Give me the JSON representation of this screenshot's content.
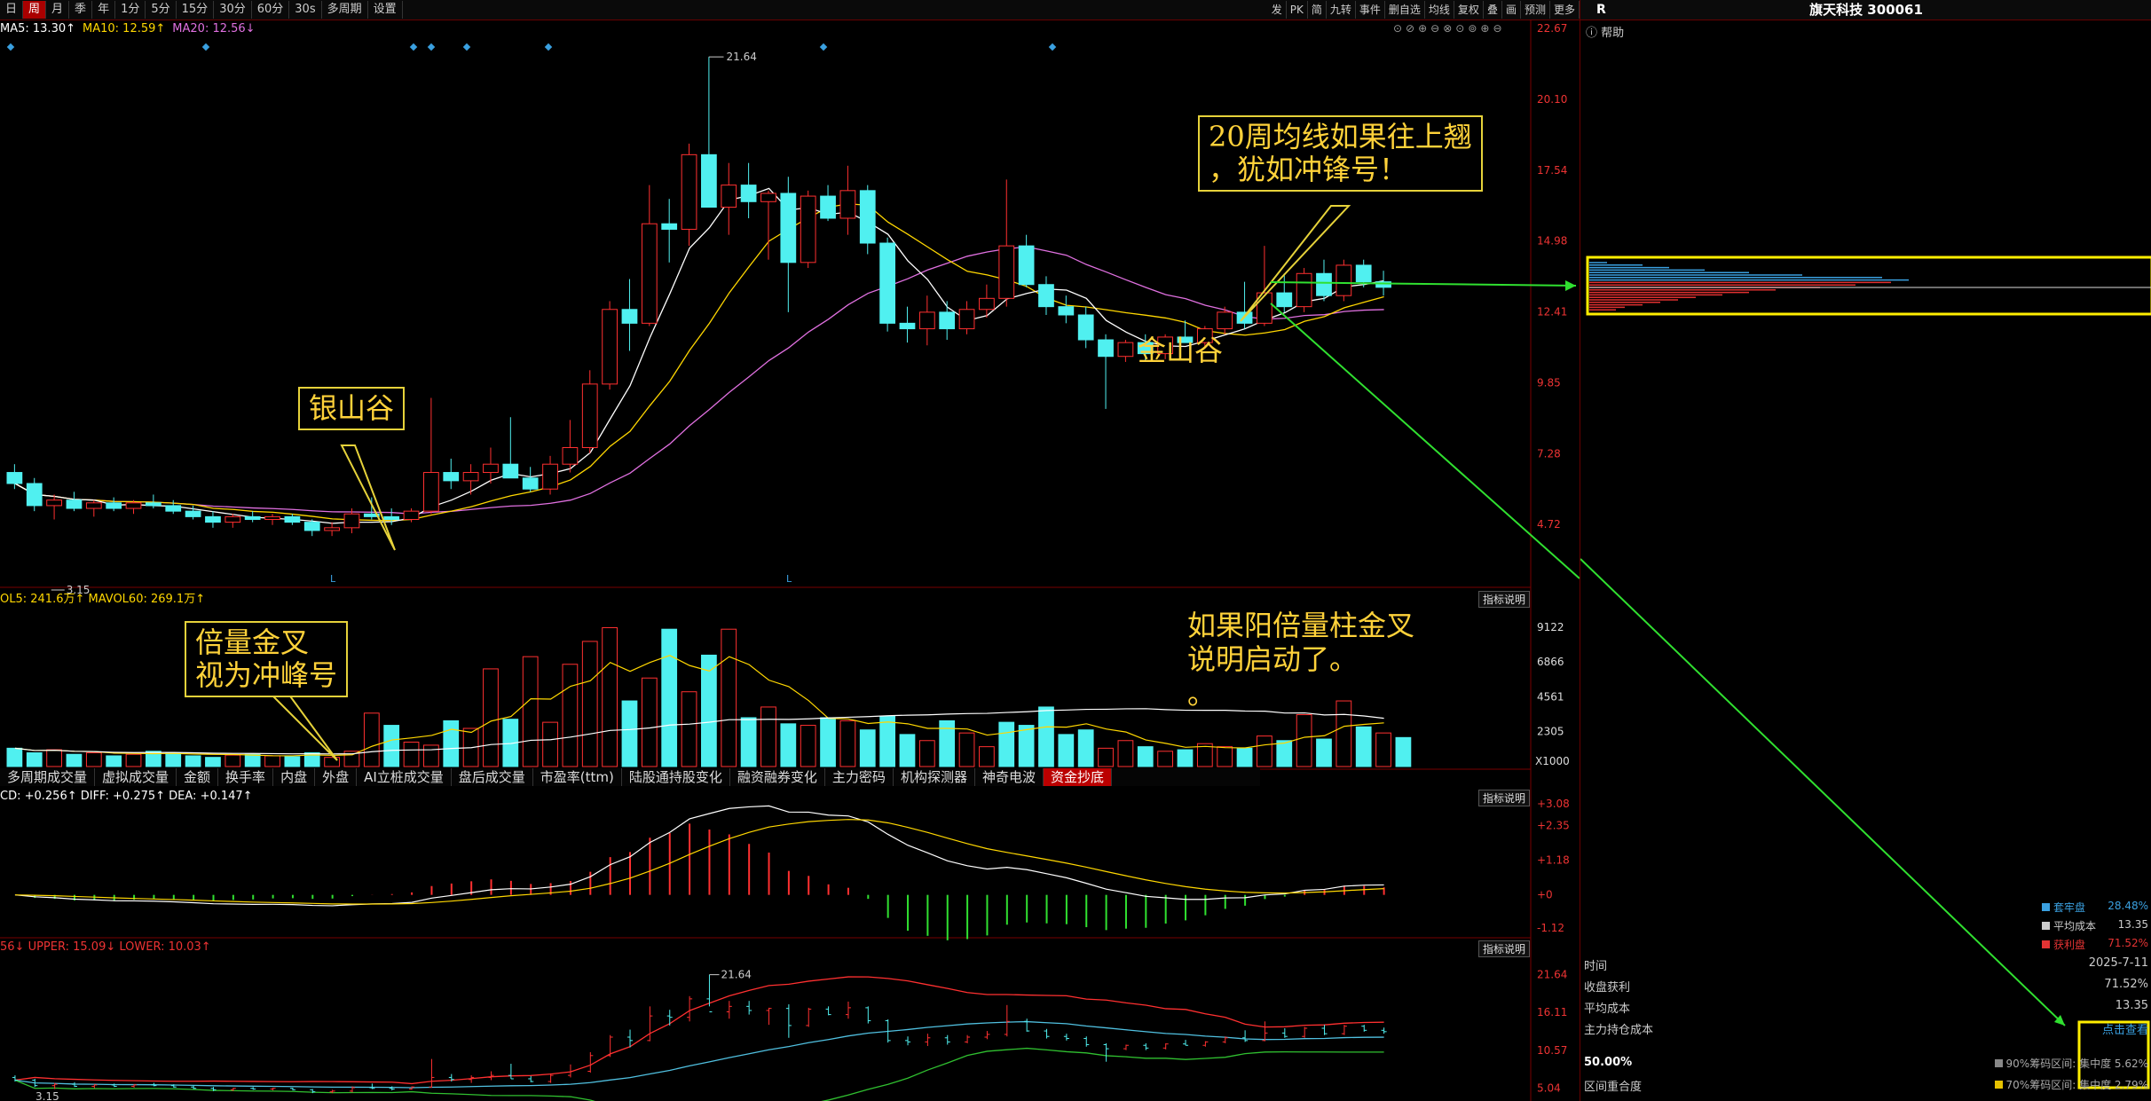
{
  "toolbar": {
    "periods": [
      "日",
      "周",
      "月",
      "季",
      "年",
      "1分",
      "5分",
      "15分",
      "30分",
      "60分",
      "30s",
      "多周期",
      "设置"
    ],
    "active_period": "周",
    "right_tools": [
      "发",
      "PK",
      "简",
      "九转",
      "事件",
      "删自选",
      "均线",
      "复权",
      "叠",
      "画",
      "预测",
      "更多"
    ]
  },
  "price_panel": {
    "ma5_label": "MA5: 13.30↑",
    "ma10_label": "MA10: 12.59↑",
    "ma20_label": "MA20: 12.56↓",
    "y_ticks": [
      "22.67",
      "20.10",
      "17.54",
      "14.98",
      "12.41",
      "9.85",
      "7.28",
      "4.72"
    ],
    "high_label": "21.64",
    "low_label": "3.15",
    "marker_l": "L"
  },
  "volume_panel": {
    "legend": "OL5: 241.6万↑  MAVOL60: 269.1万↑",
    "y_ticks": [
      "9122",
      "6866",
      "4561",
      "2305"
    ],
    "unit": "X1000"
  },
  "indicator_tabs": [
    "多周期成交量",
    "虚拟成交量",
    "金额",
    "换手率",
    "内盘",
    "外盘",
    "AI立桩成交量",
    "盘后成交量",
    "市盈率(ttm)",
    "陆股通持股变化",
    "融资融券变化",
    "主力密码",
    "机构探测器",
    "神奇电波",
    "资金抄底"
  ],
  "macd_panel": {
    "legend": "CD: +0.256↑  DIFF: +0.275↑  DEA: +0.147↑",
    "explain_button": "指标说明",
    "y_ticks": [
      "+3.08",
      "+2.35",
      "+1.18",
      "+0",
      "-1.12"
    ]
  },
  "boll_panel": {
    "legend": "56↓  UPPER: 15.09↓  LOWER: 10.03↑",
    "explain_button": "指标说明",
    "high_label": "21.64",
    "low_label": "3.15",
    "y_ticks": [
      "21.64",
      "16.11",
      "10.57",
      "5.04"
    ]
  },
  "annotations": {
    "yinshangu": "银山谷",
    "jinshangu": "金山谷",
    "ma20_note_line1": "20周均线如果往上翘",
    "ma20_note_line2": "，犹如冲锋号！",
    "vol_note_line1": "倍量金叉",
    "vol_note_line2": "视为冲峰号",
    "yang_note_line1": "如果阳倍量柱金叉",
    "yang_note_line2": "说明启动了。",
    "yang_note_line3": "。"
  },
  "right_panel": {
    "title": "旗天科技 300061",
    "r_label": "R",
    "help": "帮助",
    "legend": [
      {
        "name": "套牢盘",
        "value": "28.48%",
        "color": "#3aa0e0"
      },
      {
        "name": "平均成本",
        "value": "13.35",
        "color": "#cccccc"
      },
      {
        "name": "获利盘",
        "value": "71.52%",
        "color": "#e33333"
      }
    ],
    "rows": [
      {
        "label": "时间",
        "value": "2025-7-11"
      },
      {
        "label": "收盘获利",
        "value": "71.52%"
      },
      {
        "label": "平均成本",
        "value": "13.35"
      },
      {
        "label": "主力持仓成本",
        "value": "点击查看"
      }
    ],
    "pct": "50.00%",
    "overlap": "区间重合度",
    "range90": "90%筹码区间:",
    "range70": "70%筹码区间:",
    "conc90": "集中度  5.62%",
    "conc70": "集中度  2.79%"
  },
  "chart_data": {
    "type": "candlestick",
    "ylim": [
      3.15,
      22.67
    ],
    "candles": [
      {
        "o": 6.6,
        "h": 6.9,
        "l": 6.0,
        "c": 6.2
      },
      {
        "o": 6.2,
        "h": 6.4,
        "l": 5.2,
        "c": 5.4
      },
      {
        "o": 5.4,
        "h": 5.8,
        "l": 4.9,
        "c": 5.6
      },
      {
        "o": 5.6,
        "h": 5.9,
        "l": 5.2,
        "c": 5.3
      },
      {
        "o": 5.3,
        "h": 5.6,
        "l": 5.0,
        "c": 5.5
      },
      {
        "o": 5.5,
        "h": 5.7,
        "l": 5.2,
        "c": 5.3
      },
      {
        "o": 5.3,
        "h": 5.6,
        "l": 5.1,
        "c": 5.5
      },
      {
        "o": 5.5,
        "h": 5.8,
        "l": 5.3,
        "c": 5.4
      },
      {
        "o": 5.4,
        "h": 5.6,
        "l": 5.1,
        "c": 5.2
      },
      {
        "o": 5.2,
        "h": 5.4,
        "l": 4.9,
        "c": 5.0
      },
      {
        "o": 5.0,
        "h": 5.2,
        "l": 4.6,
        "c": 4.8
      },
      {
        "o": 4.8,
        "h": 5.1,
        "l": 4.6,
        "c": 5.0
      },
      {
        "o": 5.0,
        "h": 5.2,
        "l": 4.8,
        "c": 4.9
      },
      {
        "o": 4.9,
        "h": 5.1,
        "l": 4.7,
        "c": 5.0
      },
      {
        "o": 5.0,
        "h": 5.1,
        "l": 4.7,
        "c": 4.8
      },
      {
        "o": 4.8,
        "h": 4.9,
        "l": 4.3,
        "c": 4.5
      },
      {
        "o": 4.5,
        "h": 4.8,
        "l": 4.3,
        "c": 4.6
      },
      {
        "o": 4.6,
        "h": 5.3,
        "l": 4.4,
        "c": 5.1
      },
      {
        "o": 5.1,
        "h": 5.7,
        "l": 4.9,
        "c": 5.0
      },
      {
        "o": 5.0,
        "h": 5.3,
        "l": 4.7,
        "c": 4.9
      },
      {
        "o": 4.9,
        "h": 5.3,
        "l": 4.8,
        "c": 5.2
      },
      {
        "o": 5.2,
        "h": 9.3,
        "l": 5.1,
        "c": 6.6
      },
      {
        "o": 6.6,
        "h": 7.1,
        "l": 6.0,
        "c": 6.3
      },
      {
        "o": 6.3,
        "h": 6.9,
        "l": 5.8,
        "c": 6.6
      },
      {
        "o": 6.6,
        "h": 7.5,
        "l": 6.2,
        "c": 6.9
      },
      {
        "o": 6.9,
        "h": 8.6,
        "l": 6.4,
        "c": 6.4
      },
      {
        "o": 6.4,
        "h": 6.8,
        "l": 5.9,
        "c": 6.0
      },
      {
        "o": 6.0,
        "h": 7.2,
        "l": 5.8,
        "c": 6.9
      },
      {
        "o": 6.9,
        "h": 8.5,
        "l": 6.6,
        "c": 7.5
      },
      {
        "o": 7.5,
        "h": 10.3,
        "l": 7.3,
        "c": 9.8
      },
      {
        "o": 9.8,
        "h": 12.8,
        "l": 9.6,
        "c": 12.5
      },
      {
        "o": 12.5,
        "h": 13.6,
        "l": 11.0,
        "c": 12.0
      },
      {
        "o": 12.0,
        "h": 17.0,
        "l": 11.9,
        "c": 15.6
      },
      {
        "o": 15.6,
        "h": 16.5,
        "l": 14.2,
        "c": 15.4
      },
      {
        "o": 15.4,
        "h": 18.5,
        "l": 14.8,
        "c": 18.1
      },
      {
        "o": 18.1,
        "h": 21.64,
        "l": 17.0,
        "c": 16.2
      },
      {
        "o": 16.2,
        "h": 17.8,
        "l": 15.2,
        "c": 17.0
      },
      {
        "o": 17.0,
        "h": 17.8,
        "l": 15.8,
        "c": 16.4
      },
      {
        "o": 16.4,
        "h": 16.8,
        "l": 14.3,
        "c": 16.7
      },
      {
        "o": 16.7,
        "h": 17.3,
        "l": 12.4,
        "c": 14.2
      },
      {
        "o": 14.2,
        "h": 16.8,
        "l": 14.0,
        "c": 16.6
      },
      {
        "o": 16.6,
        "h": 17.0,
        "l": 15.7,
        "c": 15.8
      },
      {
        "o": 15.8,
        "h": 17.7,
        "l": 15.2,
        "c": 16.8
      },
      {
        "o": 16.8,
        "h": 17.0,
        "l": 14.5,
        "c": 14.9
      },
      {
        "o": 14.9,
        "h": 15.1,
        "l": 11.7,
        "c": 12.0
      },
      {
        "o": 12.0,
        "h": 12.6,
        "l": 11.3,
        "c": 11.8
      },
      {
        "o": 11.8,
        "h": 13.0,
        "l": 11.2,
        "c": 12.4
      },
      {
        "o": 12.4,
        "h": 12.8,
        "l": 11.4,
        "c": 11.8
      },
      {
        "o": 11.8,
        "h": 12.8,
        "l": 11.6,
        "c": 12.5
      },
      {
        "o": 12.5,
        "h": 13.4,
        "l": 12.2,
        "c": 12.9
      },
      {
        "o": 12.9,
        "h": 17.2,
        "l": 12.6,
        "c": 14.8
      },
      {
        "o": 14.8,
        "h": 15.2,
        "l": 13.3,
        "c": 13.4
      },
      {
        "o": 13.4,
        "h": 13.7,
        "l": 12.3,
        "c": 12.6
      },
      {
        "o": 12.6,
        "h": 13.0,
        "l": 12.0,
        "c": 12.3
      },
      {
        "o": 12.3,
        "h": 12.6,
        "l": 11.1,
        "c": 11.4
      },
      {
        "o": 11.4,
        "h": 11.6,
        "l": 8.9,
        "c": 10.8
      },
      {
        "o": 10.8,
        "h": 11.4,
        "l": 10.6,
        "c": 11.3
      },
      {
        "o": 11.3,
        "h": 11.6,
        "l": 10.6,
        "c": 10.9
      },
      {
        "o": 10.9,
        "h": 11.6,
        "l": 10.7,
        "c": 11.5
      },
      {
        "o": 11.5,
        "h": 12.1,
        "l": 11.3,
        "c": 11.3
      },
      {
        "o": 11.3,
        "h": 11.9,
        "l": 11.1,
        "c": 11.8
      },
      {
        "o": 11.8,
        "h": 12.6,
        "l": 11.6,
        "c": 12.4
      },
      {
        "o": 12.4,
        "h": 13.5,
        "l": 11.8,
        "c": 12.0
      },
      {
        "o": 12.0,
        "h": 14.8,
        "l": 11.9,
        "c": 13.1
      },
      {
        "o": 13.1,
        "h": 13.8,
        "l": 12.4,
        "c": 12.6
      },
      {
        "o": 12.6,
        "h": 14.0,
        "l": 12.4,
        "c": 13.8
      },
      {
        "o": 13.8,
        "h": 14.3,
        "l": 12.8,
        "c": 13.0
      },
      {
        "o": 13.0,
        "h": 14.3,
        "l": 12.8,
        "c": 14.1
      },
      {
        "o": 14.1,
        "h": 14.3,
        "l": 13.3,
        "c": 13.5
      },
      {
        "o": 13.5,
        "h": 13.9,
        "l": 13.0,
        "c": 13.3
      }
    ],
    "volume": [
      1200,
      900,
      1100,
      800,
      900,
      700,
      800,
      1000,
      900,
      700,
      600,
      750,
      800,
      700,
      650,
      900,
      600,
      1000,
      3500,
      2700,
      1600,
      1400,
      3000,
      2500,
      6400,
      3100,
      7200,
      2900,
      6700,
      8200,
      9100,
      4300,
      5800,
      9000,
      4900,
      7300,
      9000,
      3200,
      3900,
      2800,
      2700,
      3200,
      3000,
      2400,
      3300,
      2100,
      1700,
      3000,
      2200,
      1300,
      2900,
      2700,
      3900,
      2100,
      2400,
      1200,
      1700,
      1300,
      1000,
      1100,
      1500,
      1300,
      1200,
      2000,
      1700,
      3400,
      1800,
      4300,
      2600,
      2200,
      1900
    ],
    "volume_up": [
      false,
      false,
      true,
      false,
      true,
      false,
      true,
      false,
      false,
      false,
      false,
      true,
      false,
      true,
      false,
      false,
      true,
      true,
      true,
      false,
      true,
      true,
      false,
      true,
      true,
      false,
      true,
      true,
      true,
      true,
      true,
      false,
      true,
      false,
      true,
      false,
      true,
      false,
      true,
      false,
      true,
      false,
      true,
      false,
      false,
      false,
      true,
      false,
      true,
      true,
      false,
      false,
      false,
      false,
      false,
      true,
      true,
      false,
      true,
      false,
      true,
      true,
      false,
      true,
      false,
      true,
      false,
      true,
      false,
      true,
      false
    ]
  }
}
